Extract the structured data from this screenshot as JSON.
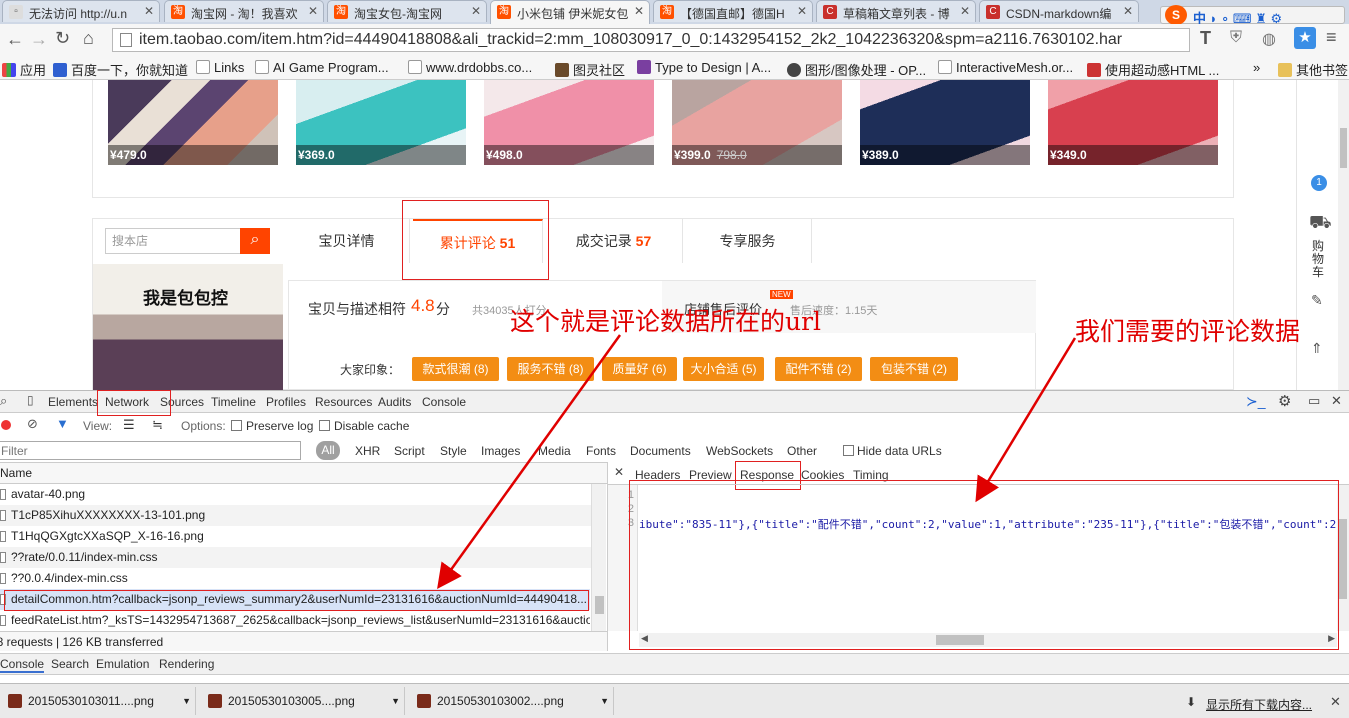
{
  "tabs": [
    {
      "label": "无法访问 http://u.n"
    },
    {
      "label": "淘宝网 - 淘！我喜欢"
    },
    {
      "label": "淘宝女包-淘宝网"
    },
    {
      "label": "小米包铺 伊米妮女包"
    },
    {
      "label": "【德国直邮】德国H"
    },
    {
      "label": "草稿箱文章列表 - 博"
    },
    {
      "label": "CSDN-markdown编"
    }
  ],
  "address": {
    "url": "item.taobao.com/item.htm?id=44490418808&ali_trackid=2:mm_108030917_0_0:1432954152_2k2_1042236320&spm=a2116.7630102.har"
  },
  "bookmarks": [
    "应用",
    "百度一下，你就知道",
    "Links",
    "AI Game Program...",
    "www.drdobbs.co...",
    "图灵社区",
    "Type to Design | A...",
    "图形/图像处理 - OP...",
    "InteractiveMesh.or...",
    "使用超动感HTML ...",
    "»",
    "其他书签"
  ],
  "products": [
    {
      "price": "¥479.0"
    },
    {
      "price": "¥369.0"
    },
    {
      "price": "¥498.0"
    },
    {
      "price": "¥399.0",
      "old": "798.0"
    },
    {
      "price": "¥389.0"
    },
    {
      "price": "¥349.0"
    }
  ],
  "shop": {
    "search_placeholder": "搜本店",
    "tabs": [
      {
        "label": "宝贝详情",
        "count": ""
      },
      {
        "label": "累计评论",
        "count": "51"
      },
      {
        "label": "成交记录",
        "count": "57"
      },
      {
        "label": "专享服务",
        "count": ""
      }
    ],
    "banner_text": "我是包包控",
    "rating_label": "宝贝与描述相符",
    "rating_value": "4.8",
    "rating_unit": "分",
    "rating_count": "共34035人打分",
    "after_sale_label": "店铺售后评价",
    "new_badge": "NEW",
    "speed": "售后速度：1.15天",
    "impression_label": "大家印象：",
    "tags": [
      "款式很潮 (8)",
      "服务不错 (8)",
      "质量好 (6)",
      "大小合适 (5)",
      "配件不错 (2)",
      "包装不错 (2)"
    ]
  },
  "side": {
    "cart_label": "购物车"
  },
  "devtools": {
    "panels": [
      "Elements",
      "Network",
      "Sources",
      "Timeline",
      "Profiles",
      "Resources",
      "Audits",
      "Console"
    ],
    "view_label": "View:",
    "options_label": "Options:",
    "preserve_log": "Preserve log",
    "disable_cache": "Disable cache",
    "filter_placeholder": "Filter",
    "types": [
      "All",
      "XHR",
      "Script",
      "Style",
      "Images",
      "Media",
      "Fonts",
      "Documents",
      "WebSockets",
      "Other"
    ],
    "hide_data_urls": "Hide data URLs",
    "name_header": "Name",
    "rows": [
      "avatar-40.png",
      "T1cP85XihuXXXXXXXX-13-101.png",
      "T1HqQGXgtcXXaSQP_X-16-16.png",
      "??rate/0.0.11/index-min.css",
      "??0.0.4/index-min.css",
      "detailCommon.htm?callback=jsonp_reviews_summary2&userNumId=23131616&auctionNumId=44490418...",
      "feedRateList.htm?_ksTS=1432954713687_2625&callback=jsonp_reviews_list&userNumId=23131616&auctio..."
    ],
    "status": "58 requests | 126 KB transferred",
    "detail_tabs": [
      "Headers",
      "Preview",
      "Response",
      "Cookies",
      "Timing"
    ],
    "line_numbers": [
      "1",
      "2",
      "3"
    ],
    "response_line": "ibute\":\"835-11\"},{\"title\":\"配件不错\",\"count\":2,\"value\":1,\"attribute\":\"235-11\"},{\"title\":\"包装不错\",\"count\":2",
    "drawer_tabs": [
      "Console",
      "Search",
      "Emulation",
      "Rendering"
    ]
  },
  "downloads": {
    "files": [
      "20150530103011....png",
      "20150530103005....png",
      "20150530103002....png"
    ],
    "show_all": "显示所有下载内容..."
  },
  "annotations": {
    "url_note": "这个就是评论数据所在的url",
    "data_note": "我们需要的评论数据"
  }
}
